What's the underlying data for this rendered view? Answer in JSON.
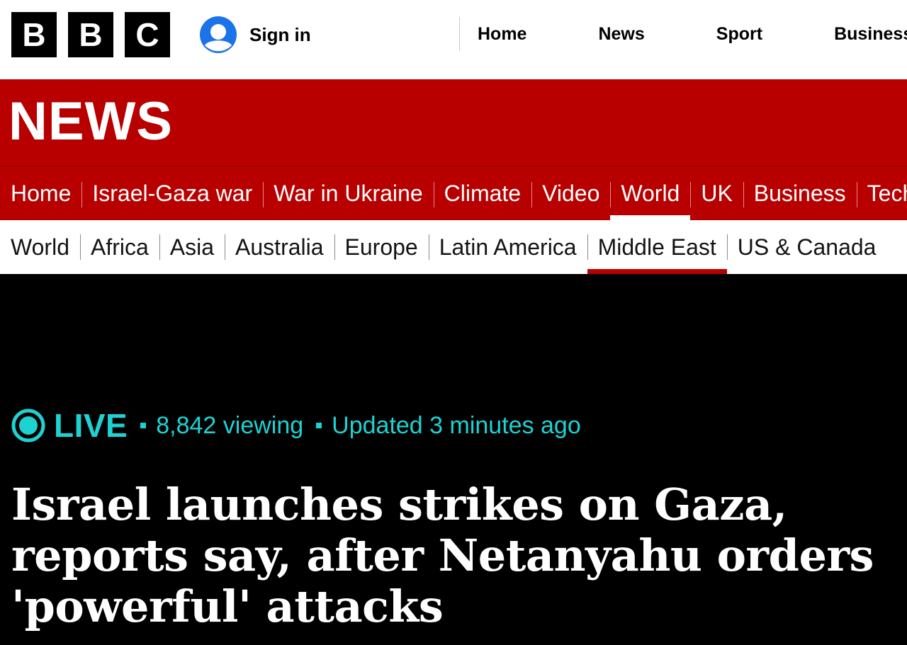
{
  "brand": {
    "logo_letters": [
      "B",
      "B",
      "C"
    ]
  },
  "account": {
    "signin_label": "Sign in",
    "icon": "user-icon"
  },
  "top_nav": {
    "items": [
      "Home",
      "News",
      "Sport",
      "Business"
    ]
  },
  "news_brand": {
    "title": "NEWS"
  },
  "primary_nav": {
    "items": [
      "Home",
      "Israel-Gaza war",
      "War in Ukraine",
      "Climate",
      "Video",
      "World",
      "UK",
      "Business",
      "Tech"
    ],
    "active": "World"
  },
  "secondary_nav": {
    "items": [
      "World",
      "Africa",
      "Asia",
      "Australia",
      "Europe",
      "Latin America",
      "Middle East",
      "US & Canada"
    ],
    "active": "Middle East"
  },
  "live": {
    "label": "LIVE",
    "viewing": "8,842 viewing",
    "updated": "Updated 3 minutes ago"
  },
  "headline": "Israel launches strikes on Gaza, reports say, after Netanyahu orders 'powerful' attacks",
  "colors": {
    "brand_red": "#b80000",
    "live_accent": "#1ed2d2",
    "signin_blue": "#1a73e8",
    "hero_background": "#000000"
  }
}
